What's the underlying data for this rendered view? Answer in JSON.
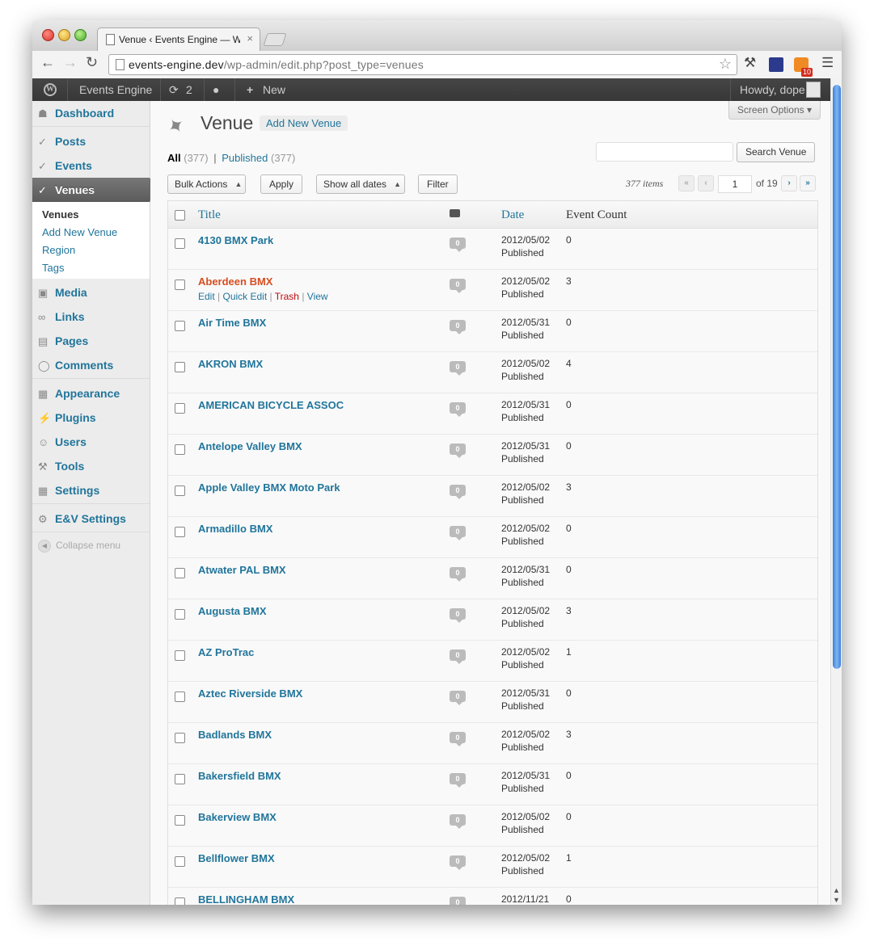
{
  "browser": {
    "tab_title": "Venue ‹ Events Engine — Wo",
    "tab_close": "×",
    "url_host": "events-engine.dev",
    "url_path": "/wp-admin/edit.php?post_type=venues",
    "rss_count": "10"
  },
  "adminbar": {
    "site_name": "Events Engine",
    "updates_count": "2",
    "new_label": "New",
    "howdy": "Howdy, dope"
  },
  "sidebar": {
    "items": [
      {
        "label": "Dashboard",
        "icon": "dashboard-icon"
      },
      {
        "label": "Posts",
        "icon": "pin-icon"
      },
      {
        "label": "Events",
        "icon": "pin-icon"
      },
      {
        "label": "Venues",
        "icon": "pin-icon"
      },
      {
        "label": "Media",
        "icon": "media-icon"
      },
      {
        "label": "Links",
        "icon": "links-icon"
      },
      {
        "label": "Pages",
        "icon": "pages-icon"
      },
      {
        "label": "Comments",
        "icon": "comments-icon"
      },
      {
        "label": "Appearance",
        "icon": "appearance-icon"
      },
      {
        "label": "Plugins",
        "icon": "plugins-icon"
      },
      {
        "label": "Users",
        "icon": "users-icon"
      },
      {
        "label": "Tools",
        "icon": "tools-icon"
      },
      {
        "label": "Settings",
        "icon": "settings-icon"
      },
      {
        "label": "E&V Settings",
        "icon": "gear-icon"
      }
    ],
    "submenu": [
      "Venues",
      "Add New Venue",
      "Region",
      "Tags"
    ],
    "collapse_label": "Collapse menu"
  },
  "page": {
    "screen_options": "Screen Options",
    "title": "Venue",
    "add_new": "Add New Venue",
    "filter_all": "All",
    "filter_all_count": "(377)",
    "filter_sep": "|",
    "filter_published": "Published",
    "filter_published_count": "(377)",
    "search_button": "Search Venue",
    "bulk_actions": "Bulk Actions",
    "apply": "Apply",
    "dates": "Show all dates",
    "filter": "Filter",
    "items_count": "377 items",
    "current_page": "1",
    "of_pages": "of 19",
    "pager_first": "«",
    "pager_prev": "‹",
    "pager_next": "›",
    "pager_last": "»"
  },
  "table": {
    "columns": {
      "title": "Title",
      "date": "Date",
      "event_count": "Event Count"
    },
    "row_actions": {
      "edit": "Edit",
      "quick_edit": "Quick Edit",
      "trash": "Trash",
      "view": "View"
    },
    "rows": [
      {
        "title": "4130 BMX Park",
        "comments": "0",
        "date": "2012/05/02",
        "status": "Published",
        "count": "0"
      },
      {
        "title": "Aberdeen BMX",
        "comments": "0",
        "date": "2012/05/02",
        "status": "Published",
        "count": "3"
      },
      {
        "title": "Air Time BMX",
        "comments": "0",
        "date": "2012/05/31",
        "status": "Published",
        "count": "0"
      },
      {
        "title": "AKRON BMX",
        "comments": "0",
        "date": "2012/05/02",
        "status": "Published",
        "count": "4"
      },
      {
        "title": "AMERICAN BICYCLE ASSOC",
        "comments": "0",
        "date": "2012/05/31",
        "status": "Published",
        "count": "0"
      },
      {
        "title": "Antelope Valley BMX",
        "comments": "0",
        "date": "2012/05/31",
        "status": "Published",
        "count": "0"
      },
      {
        "title": "Apple Valley BMX Moto Park",
        "comments": "0",
        "date": "2012/05/02",
        "status": "Published",
        "count": "3"
      },
      {
        "title": "Armadillo BMX",
        "comments": "0",
        "date": "2012/05/02",
        "status": "Published",
        "count": "0"
      },
      {
        "title": "Atwater PAL BMX",
        "comments": "0",
        "date": "2012/05/31",
        "status": "Published",
        "count": "0"
      },
      {
        "title": "Augusta BMX",
        "comments": "0",
        "date": "2012/05/02",
        "status": "Published",
        "count": "3"
      },
      {
        "title": "AZ ProTrac",
        "comments": "0",
        "date": "2012/05/02",
        "status": "Published",
        "count": "1"
      },
      {
        "title": "Aztec Riverside BMX",
        "comments": "0",
        "date": "2012/05/31",
        "status": "Published",
        "count": "0"
      },
      {
        "title": "Badlands BMX",
        "comments": "0",
        "date": "2012/05/02",
        "status": "Published",
        "count": "3"
      },
      {
        "title": "Bakersfield BMX",
        "comments": "0",
        "date": "2012/05/31",
        "status": "Published",
        "count": "0"
      },
      {
        "title": "Bakerview BMX",
        "comments": "0",
        "date": "2012/05/02",
        "status": "Published",
        "count": "0"
      },
      {
        "title": "Bellflower BMX",
        "comments": "0",
        "date": "2012/05/02",
        "status": "Published",
        "count": "1"
      },
      {
        "title": "BELLINGHAM BMX",
        "comments": "0",
        "date": "2012/11/21",
        "status": "",
        "count": "0"
      }
    ]
  }
}
